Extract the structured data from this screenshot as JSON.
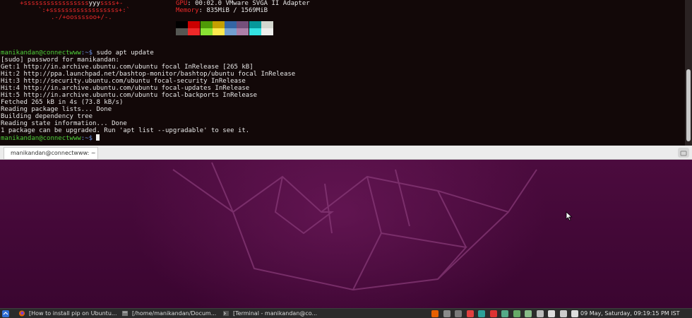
{
  "terminal": {
    "neofetch": {
      "art_line1": "+sssssssssssssssss",
      "art_line1_hi": "yyy",
      "art_line1_tail": "ssss+-",
      "art_line2": "`:+ssssssssssssssssss+:`",
      "art_line3": ".-/+oossssoo+/-.",
      "gpu_label": "GPU",
      "gpu_value": ": 00:02.0 VMware SVGA II Adapter",
      "memory_label": "Memory",
      "memory_value": ": 835MiB / 1569MiB",
      "swatches_top": [
        "#000000",
        "#cc0000",
        "#4e9a06",
        "#c4a000",
        "#3465a4",
        "#75507b",
        "#06989a",
        "#d3d7cf"
      ],
      "swatches_bottom": [
        "#555753",
        "#ef2929",
        "#8ae234",
        "#fce94f",
        "#729fcf",
        "#ad7fa8",
        "#34e2e2",
        "#eeeeec"
      ]
    },
    "prompt_user": "manikandan@connectwww",
    "prompt_path": ":~$",
    "command": "sudo apt update",
    "output": [
      "[sudo] password for manikandan:",
      "Get:1 http://in.archive.ubuntu.com/ubuntu focal InRelease [265 kB]",
      "Hit:2 http://ppa.launchpad.net/bashtop-monitor/bashtop/ubuntu focal InRelease",
      "Hit:3 http://security.ubuntu.com/ubuntu focal-security InRelease",
      "Hit:4 http://in.archive.ubuntu.com/ubuntu focal-updates InRelease",
      "Hit:5 http://in.archive.ubuntu.com/ubuntu focal-backports InRelease",
      "Fetched 265 kB in 4s (73.8 kB/s)",
      "Reading package lists... Done",
      "Building dependency tree",
      "Reading state information... Done",
      "1 package can be upgraded. Run 'apt list --upgradable' to see it."
    ],
    "tab_title": "manikandan@connectwww: ~"
  },
  "panel": {
    "tasks": [
      {
        "label": "[How to install pip on Ubuntu...",
        "icon": "firefox-icon"
      },
      {
        "label": "[/home/manikandan/Docum...",
        "icon": "file-manager-icon"
      },
      {
        "label": "[Terminal - manikandan@co...",
        "icon": "terminal-icon"
      }
    ],
    "clock": "09 May, Saturday, 09:19:15 PM IST",
    "tray_colors": [
      "#e66000",
      "#8a8a8a",
      "#7a7a7a",
      "#e04040",
      "#2aa198",
      "#d33",
      "#5a8",
      "#6a6",
      "#8b8",
      "#bbb",
      "#ddd",
      "#ccc",
      "#ddd"
    ]
  },
  "colors": {
    "terminal_bg": "#120808",
    "prompt_green": "#4fd13a",
    "neofetch_red": "#ee2a2a",
    "wallpaper_purple": "#4e0c40"
  }
}
